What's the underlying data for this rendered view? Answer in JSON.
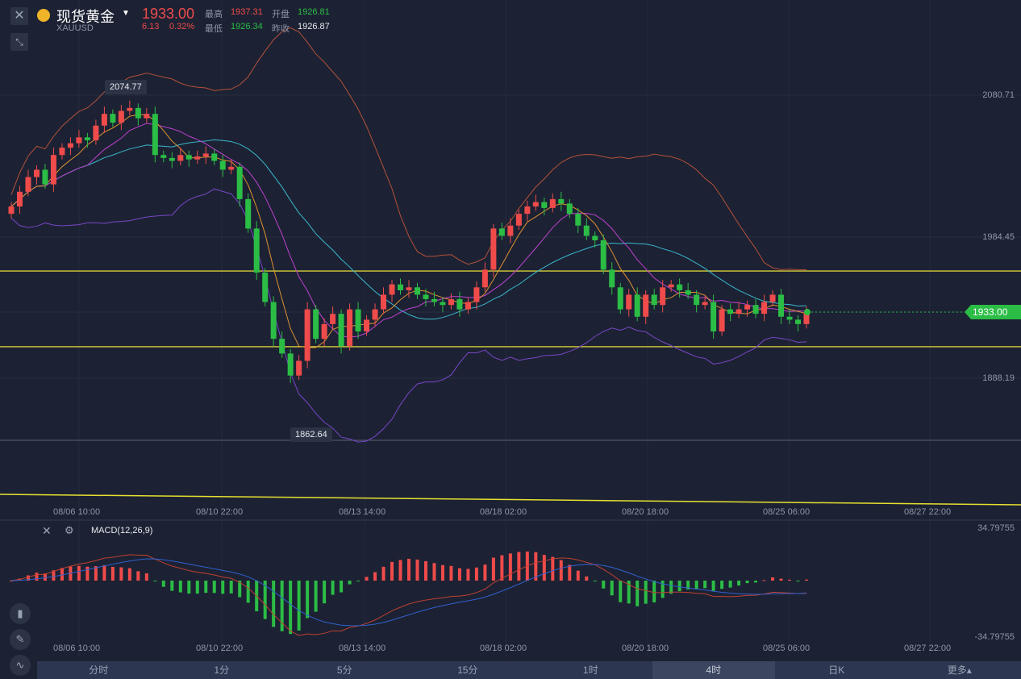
{
  "header": {
    "name": "现货黄金",
    "symbol": "XAUUSD",
    "price": "1933.00",
    "change": "6.13",
    "change_pct": "0.32%",
    "high_label": "最高",
    "high": "1937.31",
    "open_label": "开盘",
    "open": "1926.81",
    "low_label": "最低",
    "low": "1926.34",
    "prev_label": "昨收",
    "prev": "1926.87"
  },
  "price_axis": [
    "2080.71",
    "1984.45",
    "1888.19"
  ],
  "current_price_tag": "1933.00",
  "max_label": "2074.77",
  "min_label": "1862.64",
  "time_axis": [
    "08/06 10:00",
    "08/10 22:00",
    "08/13 14:00",
    "08/18 02:00",
    "08/20 18:00",
    "08/25 06:00",
    "08/27 22:00"
  ],
  "macd": {
    "title": "MACD(12,26,9)",
    "max": "34.79755",
    "min": "-34.79755"
  },
  "tabs": [
    "分时",
    "1分",
    "5分",
    "15分",
    "1时",
    "4时",
    "日K",
    "更多▴"
  ],
  "active_tab": 5,
  "colors": {
    "up": "#ef4b4b",
    "down": "#2bbd45",
    "bg": "#1c2233",
    "yellow": "#d8d03a"
  },
  "chart_data": {
    "type": "candlestick",
    "closes": [
      2005,
      2015,
      2025,
      2030,
      2020,
      2040,
      2045,
      2048,
      2052,
      2050,
      2060,
      2068,
      2062,
      2070,
      2072,
      2065,
      2068,
      2040,
      2038,
      2036,
      2040,
      2037,
      2039,
      2041,
      2036,
      2030,
      2032,
      2010,
      1990,
      1960,
      1940,
      1915,
      1905,
      1890,
      1900,
      1935,
      1915,
      1925,
      1932,
      1910,
      1935,
      1920,
      1928,
      1935,
      1945,
      1952,
      1948,
      1950,
      1945,
      1942,
      1940,
      1938,
      1942,
      1935,
      1940,
      1950,
      1962,
      1990,
      1985,
      1992,
      2000,
      2005,
      2008,
      2004,
      2010,
      2007,
      2000,
      1992,
      1985,
      1982,
      1962,
      1950,
      1935,
      1945,
      1930,
      1945,
      1938,
      1950,
      1952,
      1948,
      1945,
      1938,
      1940,
      1920,
      1935,
      1932,
      1935,
      1938,
      1932,
      1940,
      1945,
      1930,
      1928,
      1925,
      1933
    ],
    "horizontal_lines": [
      1961.1,
      1909.6
    ],
    "ylim_ref": [
      1888.19,
      2080.71
    ]
  }
}
